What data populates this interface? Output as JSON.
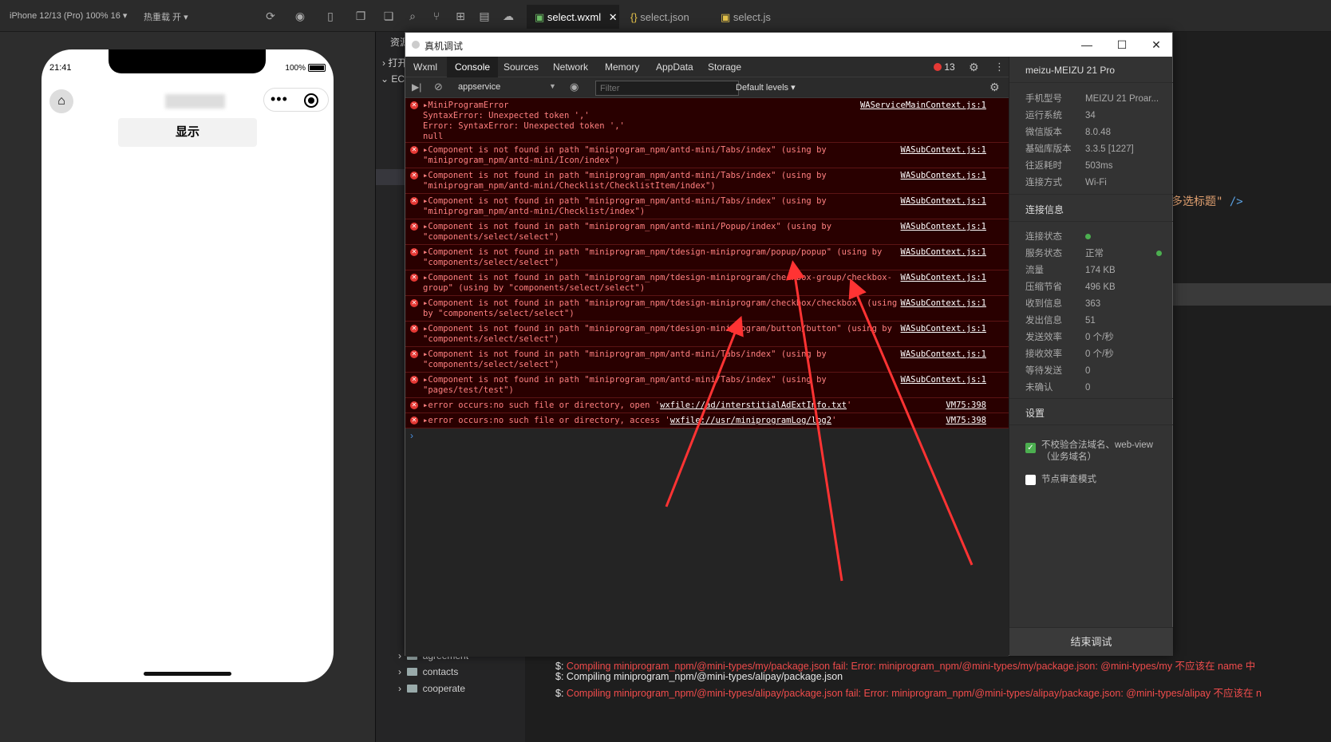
{
  "topbar": {
    "sim_info": "iPhone 12/13 (Pro) 100% 16 ▾",
    "hot_reload": "热重载 开 ▾",
    "tabs": [
      {
        "label": "select.wxml",
        "active": true
      },
      {
        "label": "select.json",
        "active": false
      },
      {
        "label": "select.js",
        "active": false
      }
    ],
    "close_mark": "✕"
  },
  "phone": {
    "time": "21:41",
    "battery": "100%",
    "button_label": "显示"
  },
  "explorer": {
    "resource_label": "资源",
    "open_label": "打开",
    "eca_label": "ECA",
    "folders": [
      "agreement",
      "contacts",
      "cooperate"
    ]
  },
  "editor": {
    "code_fragment_text": "多选标题\"",
    "code_fragment_tag": "/>"
  },
  "terminal": [
    {
      "prefix": "$:",
      "text": "Compiling miniprogram_npm/@mini-types/my/package.json fail: Error: miniprogram_npm/@mini-types/my/package.json: @mini-types/my 不应该在 name 中",
      "status": "error"
    },
    {
      "prefix": "$:",
      "text": "Compiling miniprogram_npm/@mini-types/alipay/package.json",
      "status": "ok"
    },
    {
      "prefix": "$:",
      "text": "Compiling miniprogram_npm/@mini-types/alipay/package.json fail: Error: miniprogram_npm/@mini-types/alipay/package.json: @mini-types/alipay 不应该在 n",
      "status": "error"
    }
  ],
  "debug_window": {
    "title": "真机调试",
    "win_controls": {
      "min": "—",
      "max": "☐",
      "close": "✕"
    },
    "tabs": [
      "Wxml",
      "Console",
      "Sources",
      "Network",
      "Memory",
      "AppData",
      "Storage"
    ],
    "active_tab": "Console",
    "error_count": "13",
    "context_select": "appservice",
    "filter_placeholder": "Filter",
    "levels": "Default levels ▾",
    "logs": [
      {
        "text": "▸MiniProgramError\nSyntaxError: Unexpected token ','\nError: SyntaxError: Unexpected token ','\nnull",
        "source": "WAServiceMainContext.js:1"
      },
      {
        "text": "▸Component is not found in path \"miniprogram_npm/antd-mini/Tabs/index\" (using by\n\"miniprogram_npm/antd-mini/Icon/index\")",
        "source": "WASubContext.js:1"
      },
      {
        "text": "▸Component is not found in path \"miniprogram_npm/antd-mini/Tabs/index\" (using by\n\"miniprogram_npm/antd-mini/Checklist/ChecklistItem/index\")",
        "source": "WASubContext.js:1"
      },
      {
        "text": "▸Component is not found in path \"miniprogram_npm/antd-mini/Tabs/index\" (using by\n\"miniprogram_npm/antd-mini/Checklist/index\")",
        "source": "WASubContext.js:1"
      },
      {
        "text": "▸Component is not found in path \"miniprogram_npm/antd-mini/Popup/index\" (using by\n\"components/select/select\")",
        "source": "WASubContext.js:1"
      },
      {
        "text": "▸Component is not found in path \"miniprogram_npm/tdesign-miniprogram/popup/popup\" (using by\n\"components/select/select\")",
        "source": "WASubContext.js:1"
      },
      {
        "text": "▸Component is not found in path \"miniprogram_npm/tdesign-miniprogram/checkbox-group/checkbox-\ngroup\" (using by \"components/select/select\")",
        "source": "WASubContext.js:1"
      },
      {
        "text": "▸Component is not found in path \"miniprogram_npm/tdesign-miniprogram/checkbox/checkbox\" (using\nby \"components/select/select\")",
        "source": "WASubContext.js:1"
      },
      {
        "text": "▸Component is not found in path \"miniprogram_npm/tdesign-miniprogram/button/button\" (using by\n\"components/select/select\")",
        "source": "WASubContext.js:1"
      },
      {
        "text": "▸Component is not found in path \"miniprogram_npm/antd-mini/Tabs/index\" (using by\n\"components/select/select\")",
        "source": "WASubContext.js:1"
      },
      {
        "text": "▸Component is not found in path \"miniprogram_npm/antd-mini/Tabs/index\" (using by\n\"pages/test/test\")",
        "source": "WASubContext.js:1"
      },
      {
        "pre": "▸error occurs:no such file or directory, open '",
        "link": "wxfile://ad/interstitialAdExtInfo.txt",
        "post": "'",
        "source": "VM75:398"
      },
      {
        "pre": "▸error occurs:no such file or directory, access '",
        "link": "wxfile://usr/miniprogramLog/log2",
        "post": "'",
        "source": "VM75:398"
      }
    ],
    "prompt": "›"
  },
  "device_info": {
    "device_name": "meizu-MEIZU 21 Pro",
    "rows": [
      {
        "k": "手机型号",
        "v": "MEIZU 21 Proar..."
      },
      {
        "k": "运行系统",
        "v": "34"
      },
      {
        "k": "微信版本",
        "v": "8.0.48"
      },
      {
        "k": "基础库版本",
        "v": "3.3.5 [1227]"
      },
      {
        "k": "往返耗时",
        "v": "503ms"
      },
      {
        "k": "连接方式",
        "v": "Wi-Fi"
      }
    ],
    "conn_head": "连接信息",
    "conn_rows": [
      {
        "k": "连接状态",
        "v": ""
      },
      {
        "k": "服务状态",
        "v": "正常"
      },
      {
        "k": "流量",
        "v": "174 KB"
      },
      {
        "k": "压缩节省",
        "v": "496 KB"
      },
      {
        "k": "收到信息",
        "v": "363"
      },
      {
        "k": "发出信息",
        "v": "51"
      },
      {
        "k": "发送效率",
        "v": "0 个/秒"
      },
      {
        "k": "接收效率",
        "v": "0 个/秒"
      },
      {
        "k": "等待发送",
        "v": "0"
      },
      {
        "k": "未确认",
        "v": "0"
      }
    ],
    "settings_head": "设置",
    "settings": [
      {
        "label": "不校验合法域名、web-view（业务域名）",
        "checked": true
      },
      {
        "label": "节点审查模式",
        "checked": false
      }
    ],
    "end_button": "结束调试"
  },
  "colors": {
    "error_bg": "#290000",
    "error_text": "#ff8080",
    "arrow": "#ff3333",
    "accent_green": "#4caf50"
  }
}
